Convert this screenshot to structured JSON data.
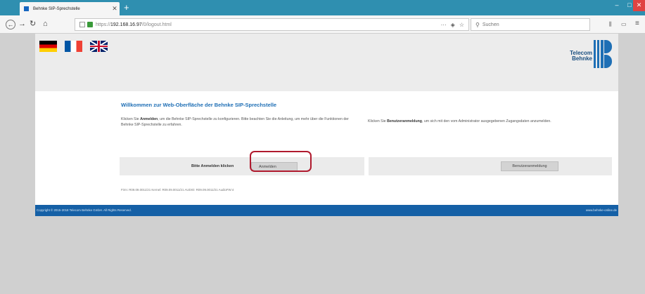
{
  "browser": {
    "tab_title": "Behnke SIP-Sprechstelle",
    "tab_close": "✕",
    "new_tab": "+",
    "url_prefix": "https://",
    "url_host": "192.168.16.97",
    "url_path": "/0/logout.html",
    "url_actions": "···",
    "search_placeholder": "Suchen",
    "window_min": "–",
    "window_max": "□",
    "window_close": "✕"
  },
  "header": {
    "flags": [
      "de",
      "fr",
      "uk"
    ],
    "logo_line1": "Telecom",
    "logo_line2": "Behnke",
    "brand_color": "#1e6fb5"
  },
  "main": {
    "title": "Willkommen zur Web-Oberfläche der Behnke SIP-Sprechstelle",
    "intro_left_pre": "Klicken Sie ",
    "intro_left_bold": "Anmelden",
    "intro_left_post": ", um die Behnke SIP-Sprechstelle zu konfigurieren. Bitte beachten Sie die Anleitung, um mehr über die Funktionen der Behnke SIP-Sprechstelle zu erfahren.",
    "intro_right_pre": "Klicken Sie ",
    "intro_right_bold": "Benutzeranmeldung",
    "intro_right_post": ", um sich mit den vom Administrator ausgegebenen Zugangsdaten anzumelden.",
    "login_prompt": "Bitte Anmelden klicken",
    "login_button": "Anmelden",
    "user_login_button": "Benutzeranmeldung",
    "firmware_info": "Firm: R09.09.0011/21 Kernel: R09.09.0011/21 AUDIO: R09.09.0011/21 AudioFW:4"
  },
  "footer": {
    "copyright": "Copyright © 2015-2018 Telecom Behnke GmbH. All Rights Reserved.",
    "website": "www.behnke-online.de",
    "color": "#1560a6"
  },
  "highlight_color": "#b01a2e"
}
